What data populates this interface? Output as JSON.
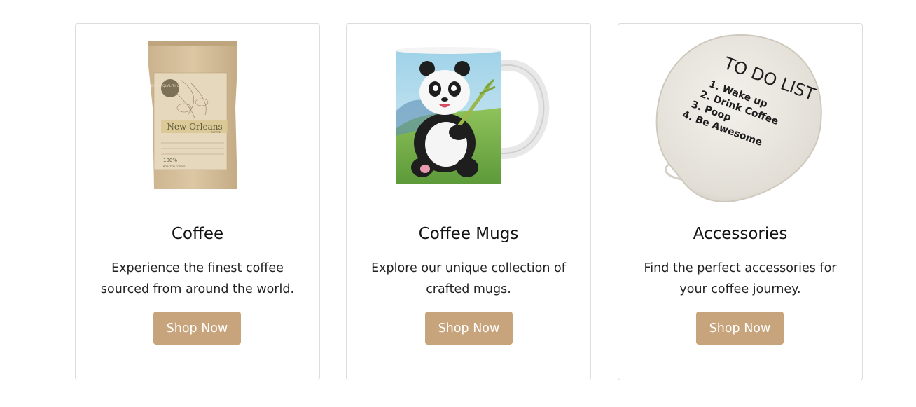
{
  "cards": [
    {
      "title": "Coffee",
      "text": "Experience the finest coffee sourced from around the world.",
      "button": "Shop Now",
      "image": {
        "badge": "GREAT QUALITY COFFEE",
        "brand": "New Orleans",
        "brand_sub": "COFFEE",
        "percent": "100%",
        "percent_sub": "ROASTED COFFEE"
      }
    },
    {
      "title": "Coffee Mugs",
      "text": "Explore our unique collection of crafted mugs.",
      "button": "Shop Now"
    },
    {
      "title": "Accessories",
      "text": "Find the perfect accessories for your coffee journey.",
      "button": "Shop Now",
      "image": {
        "heading": "TO DO LIST",
        "items": [
          "1.  Wake up",
          "2.  Drink Coffee",
          "3.  Poop",
          "4.  Be Awesome"
        ]
      }
    }
  ],
  "colors": {
    "button": "#c8a47c",
    "border": "#dcdcdc"
  }
}
